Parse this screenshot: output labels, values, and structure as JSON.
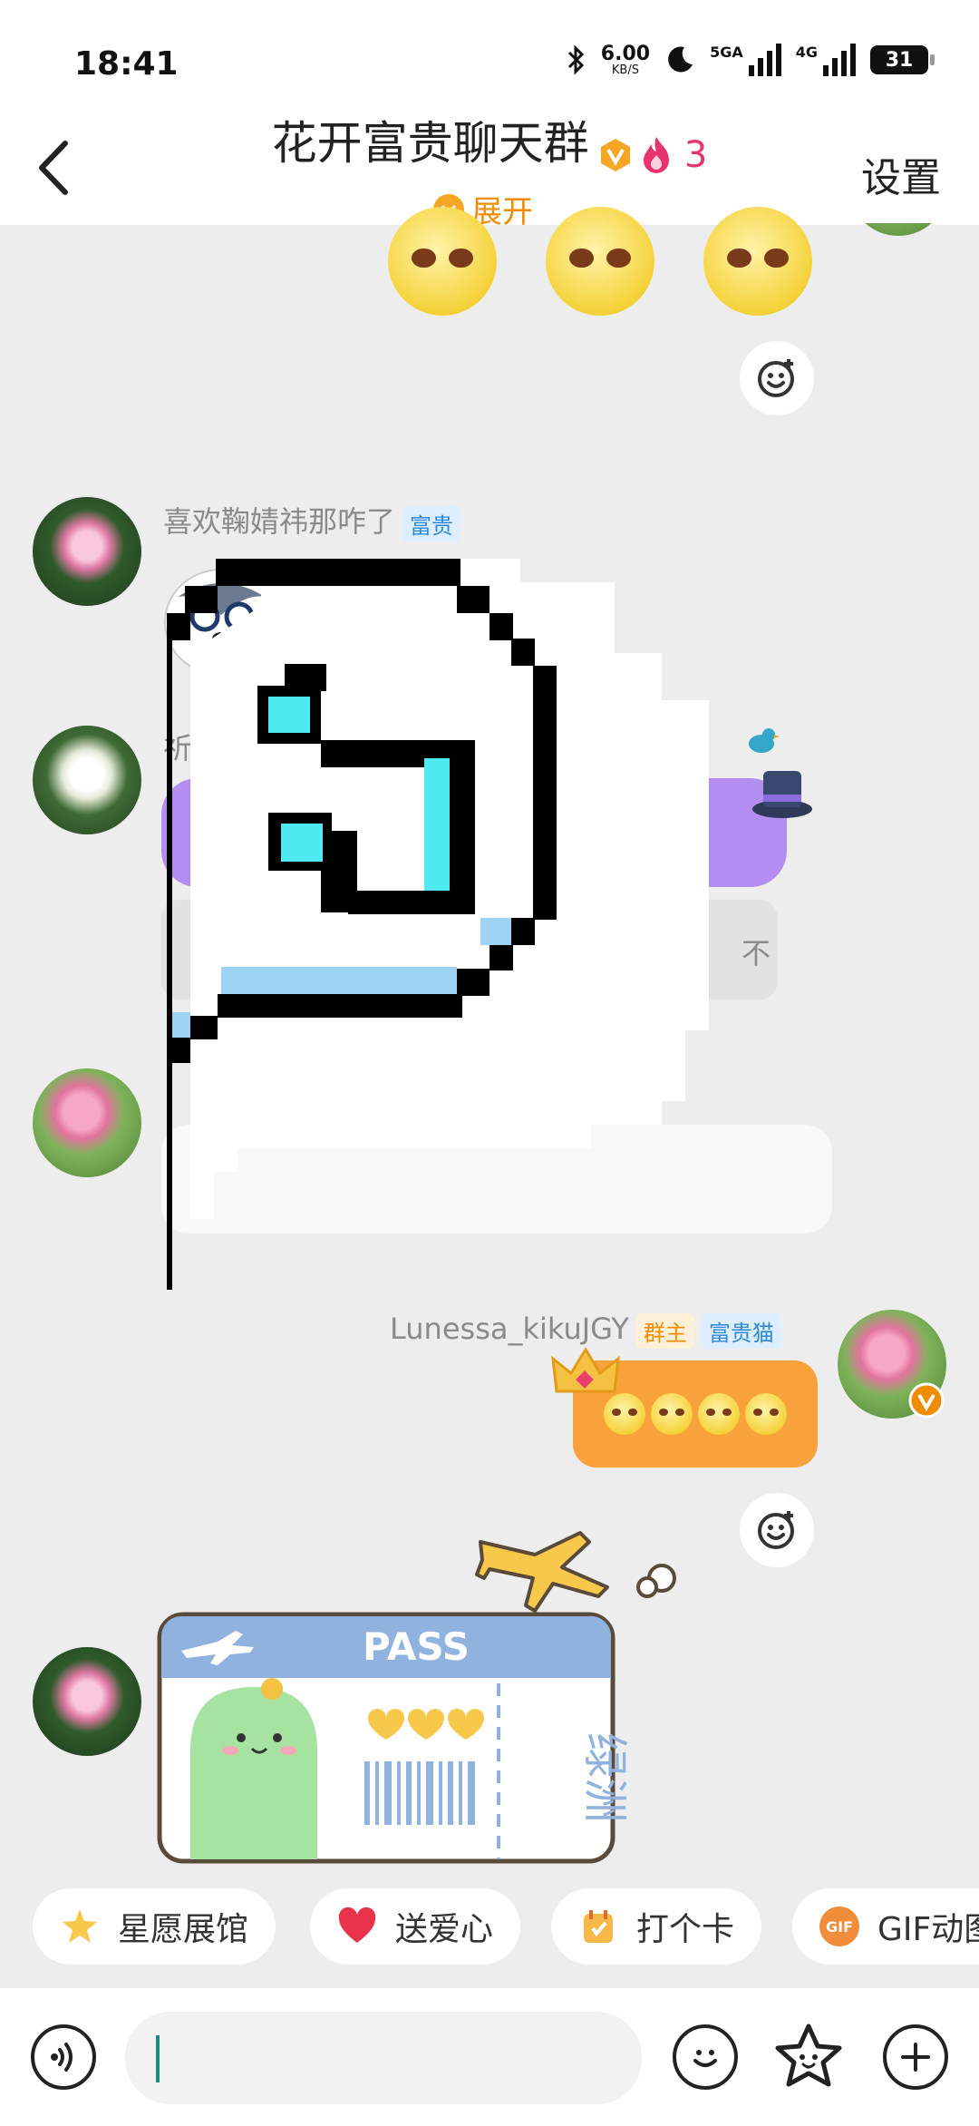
{
  "status_bar": {
    "time": "18:41",
    "net_speed_value": "6.00",
    "net_speed_unit": "KB/S",
    "sim1_label": "5GA",
    "sim2_label": "4G",
    "battery": "31",
    "icons": [
      "bluetooth-icon",
      "moon-icon",
      "signal-icon",
      "battery-icon"
    ]
  },
  "header": {
    "title": "花开富贵聊天群",
    "fire_count": "3",
    "settings_label": "设置",
    "expand_label": "展开"
  },
  "messages": [
    {
      "sender": "喜欢鞠婧祎那咋了",
      "tag": "富贵",
      "content": "husky-sticker"
    },
    {
      "sender": "祈",
      "content": "purple-bubble"
    },
    {
      "sender": "Lunessa_kikuJGY",
      "tags": [
        "群主",
        "富贵猫"
      ],
      "content": "doge-emoji x4"
    },
    {
      "sender": "",
      "content": "boarding-pass-sticker"
    }
  ],
  "boarding_pass": {
    "title": "PASS",
    "destination": "绿洲"
  },
  "quick_actions": [
    {
      "label": "星愿展馆",
      "icon": "star-icon"
    },
    {
      "label": "送爱心",
      "icon": "heart-icon"
    },
    {
      "label": "打个卡",
      "icon": "checkin-icon"
    },
    {
      "label": "GIF动图",
      "icon": "gif-icon"
    }
  ],
  "gif_icon_text": "GIF",
  "grey_tail_text": "不",
  "colors": {
    "accent": "#f5a623",
    "orange_bubble": "#f9a13a",
    "purple_bubble": "#b48df0",
    "fire": "#e8336d"
  }
}
